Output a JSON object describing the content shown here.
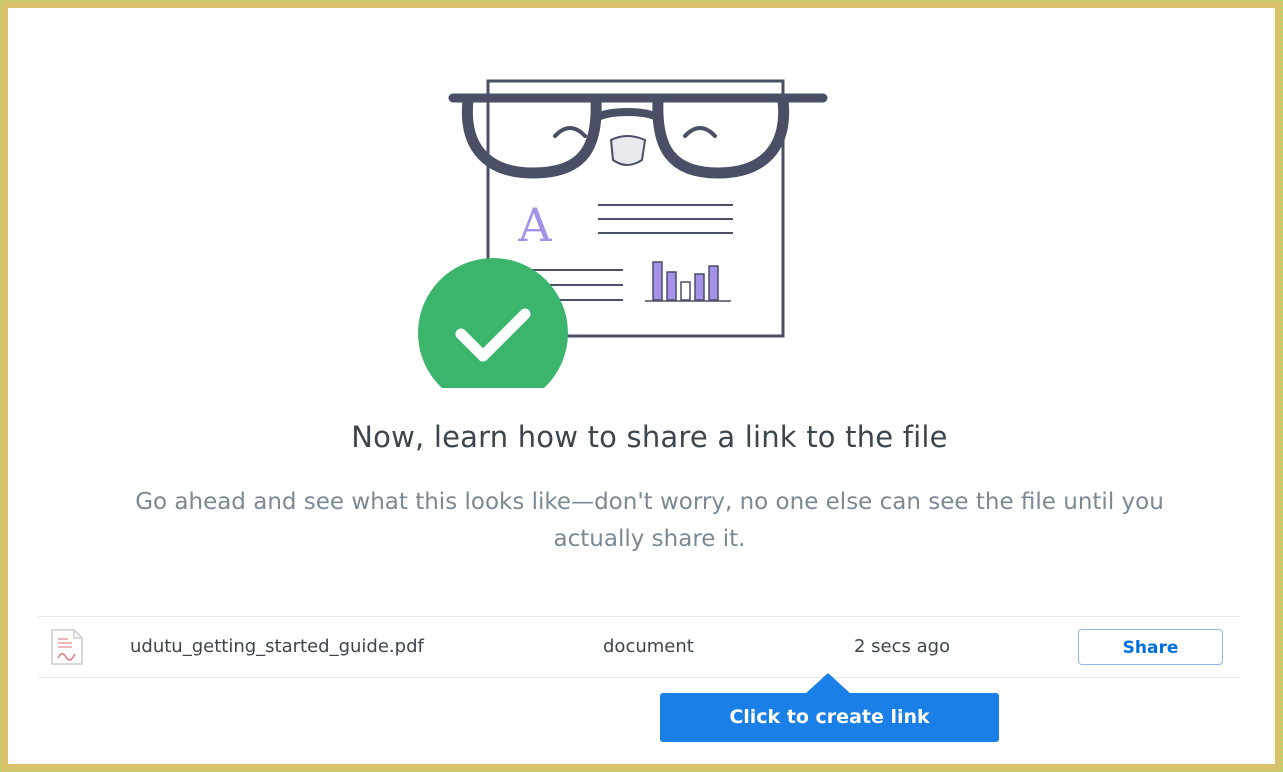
{
  "headline": "Now, learn how to share a link to the file",
  "subtext": "Go ahead and see what this looks like—don't worry, no one else can see the file until you actually share it.",
  "illustration": {
    "letter": "A",
    "check_color": "#3bb56b",
    "accent_color": "#a592e8"
  },
  "file": {
    "name": "udutu_getting_started_guide.pdf",
    "type": "document",
    "modified": "2 secs ago",
    "icon": "pdf-file-icon"
  },
  "share_button": {
    "label": "Share"
  },
  "tooltip": {
    "label": "Click to create link"
  },
  "colors": {
    "primary": "#1a7fe6",
    "link": "#0070e0",
    "heading": "#3d464d",
    "muted": "#7b8994"
  }
}
